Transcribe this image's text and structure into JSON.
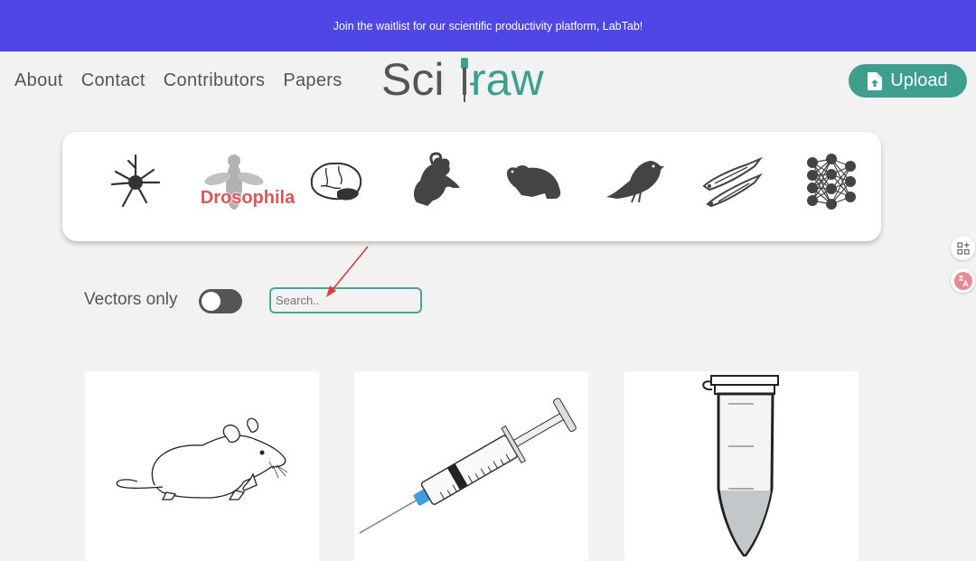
{
  "banner": {
    "text": "Join the waitlist for our scientific productivity platform, LabTab!"
  },
  "nav": {
    "items": [
      "About",
      "Contact",
      "Contributors",
      "Papers"
    ]
  },
  "logo": {
    "text_left": "Sci",
    "text_right": "raw"
  },
  "header": {
    "upload_label": "Upload",
    "upload_icon": "file-upload-icon"
  },
  "categories": [
    {
      "icon": "neuron-icon"
    },
    {
      "icon": "drosophila-icon",
      "label": "Drosophila"
    },
    {
      "icon": "brain-icon"
    },
    {
      "icon": "rat-icon"
    },
    {
      "icon": "mouse-icon"
    },
    {
      "icon": "finch-icon"
    },
    {
      "icon": "zebrafish-icon"
    },
    {
      "icon": "neural-network-icon"
    }
  ],
  "filters": {
    "vectors_only_label": "Vectors only",
    "vectors_only_on": false,
    "search_placeholder": "Search..",
    "search_value": ""
  },
  "side_tools": [
    {
      "icon": "grid-plus-icon"
    },
    {
      "icon": "translate-icon"
    }
  ],
  "cards": [
    {
      "image": "mouse-drawing"
    },
    {
      "image": "syringe-drawing"
    },
    {
      "image": "microcentrifuge-tube-drawing"
    }
  ],
  "colors": {
    "banner": "#4e46e5",
    "accent": "#3f9f8f",
    "search_border": "#4aa69a",
    "annotation_arrow": "#e53935"
  }
}
